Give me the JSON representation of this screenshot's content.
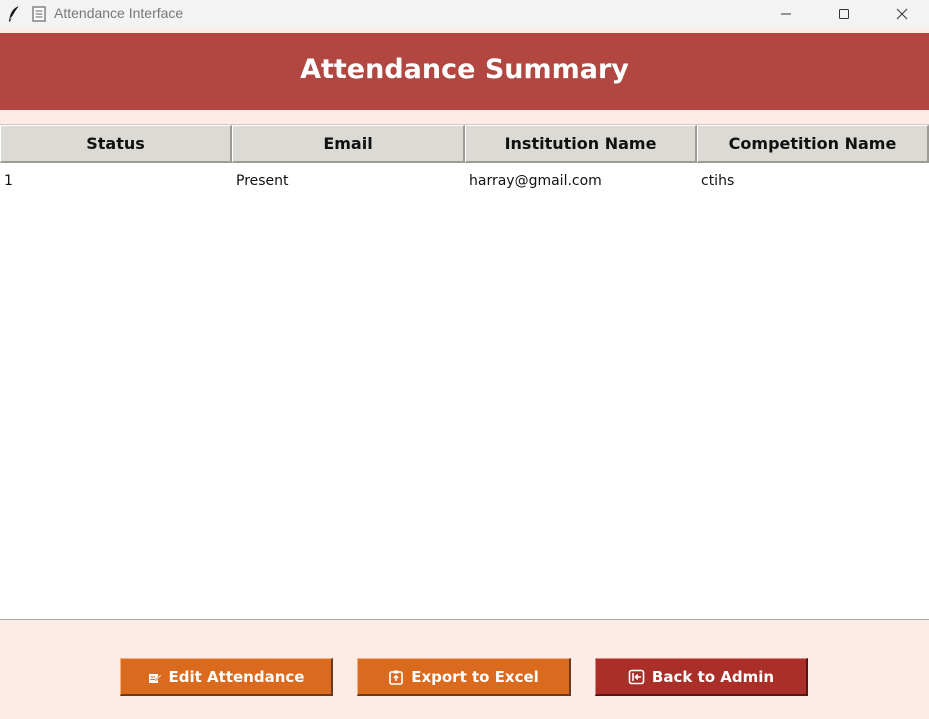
{
  "window": {
    "title": "Attendance Interface",
    "controls": [
      "minimize-icon",
      "maximize-icon",
      "close-icon"
    ]
  },
  "header": {
    "title": "Attendance Summary",
    "background": "#b24640"
  },
  "table": {
    "columns": [
      "Status",
      "Email",
      "Institution Name",
      "Competition Name"
    ],
    "rows": [
      [
        "1",
        "Present",
        "harray@gmail.com",
        "ctihs"
      ]
    ]
  },
  "footer": {
    "buttons": {
      "edit": {
        "label": "Edit Attendance",
        "icon": "edit-document-icon",
        "color": "#d96a1e"
      },
      "export": {
        "label": "Export to Excel",
        "icon": "export-clipboard-icon",
        "color": "#d96a1e"
      },
      "back": {
        "label": "Back to Admin",
        "icon": "exit-door-icon",
        "color": "#a92f28"
      }
    }
  },
  "colors": {
    "page_background": "#fdece6",
    "table_header_background": "#dcdad5"
  }
}
